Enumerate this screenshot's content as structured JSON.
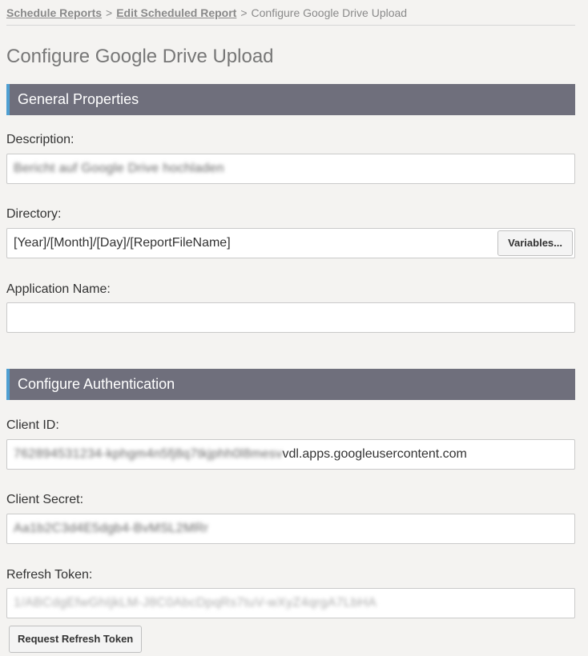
{
  "breadcrumb": {
    "items": [
      "Schedule Reports",
      "Edit Scheduled Report"
    ],
    "separator": ">",
    "current": "Configure Google Drive Upload"
  },
  "page_title": "Configure Google Drive Upload",
  "general": {
    "header": "General Properties",
    "description_label": "Description:",
    "description_value": "Bericht auf Google Drive hochladen",
    "directory_label": "Directory:",
    "directory_value": "[Year]/[Month]/[Day]/[ReportFileName]",
    "variables_button": "Variables...",
    "app_name_label": "Application Name:",
    "app_name_value": ""
  },
  "auth": {
    "header": "Configure Authentication",
    "client_id_label": "Client ID:",
    "client_id_hidden": "762894531234-kphgm4n5fj8q7tkjphh0l8mesv",
    "client_id_visible": "vdl.apps.googleusercontent.com",
    "client_secret_label": "Client Secret:",
    "client_secret_value": "Aa1b2C3d4E5dgb4-BvMSL2MRr",
    "refresh_token_label": "Refresh Token:",
    "refresh_token_value": "1/ABCdgEfwGhIjkLM-J8C0AbcDpqRs7tuV-wXyZ4qrgA7LbHA",
    "request_button": "Request Refresh Token"
  }
}
